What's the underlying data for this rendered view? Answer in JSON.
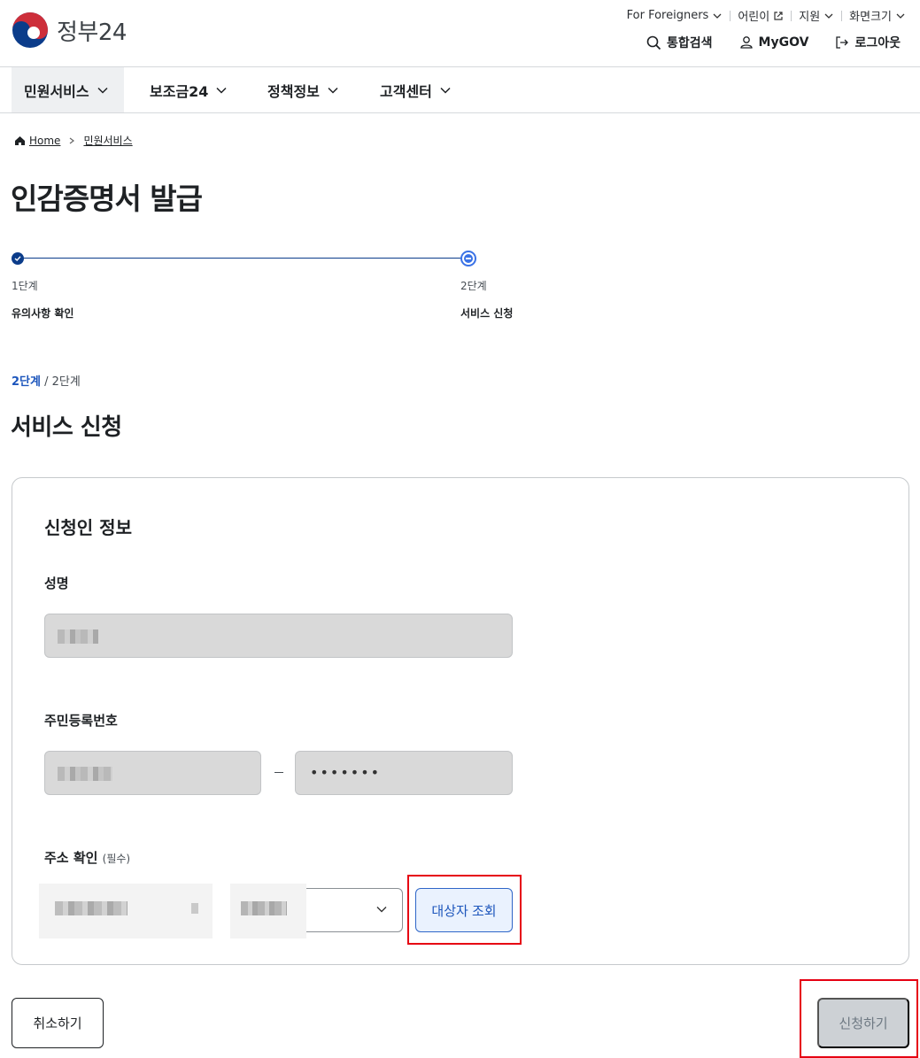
{
  "brand": {
    "name": "정부24"
  },
  "utility": {
    "foreigners": "For Foreigners",
    "kids": "어린이",
    "support": "지원",
    "screen_size": "화면크기"
  },
  "tools": {
    "search": "통합검색",
    "mygov": "MyGOV",
    "logout": "로그아웃"
  },
  "gnb": [
    "민원서비스",
    "보조금24",
    "정책정보",
    "고객센터"
  ],
  "breadcrumb": {
    "home": "Home",
    "current": "민원서비스"
  },
  "page_title": "인감증명서 발급",
  "steps": [
    {
      "num": "1단계",
      "name": "유의사항 확인",
      "status": "done"
    },
    {
      "num": "2단계",
      "name": "서비스 신청",
      "status": "current"
    }
  ],
  "step_indicator": {
    "current": "2단계",
    "separator": "/",
    "total": "2단계"
  },
  "section_title": "서비스 신청",
  "form": {
    "title": "신청인 정보",
    "name_label": "성명",
    "rrn_label": "주민등록번호",
    "rrn_dash": "–",
    "rrn_back_mask": "•••••••",
    "address_label": "주소 확인",
    "address_required": "(필수)",
    "lookup_button": "대상자 조회"
  },
  "actions": {
    "cancel": "취소하기",
    "submit": "신청하기"
  },
  "colors": {
    "brand_blue": "#0b3c8a",
    "accent": "#1d56bc",
    "highlight": "#e60012",
    "disabled_bg": "#cdd1d5"
  }
}
